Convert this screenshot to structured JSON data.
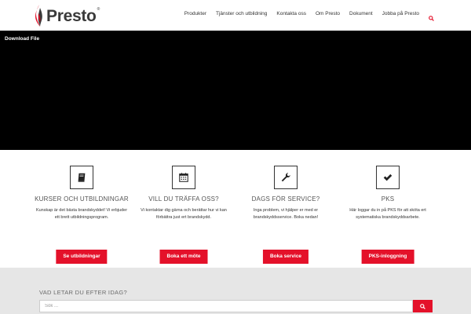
{
  "brand": {
    "name": "Presto",
    "registered": "®",
    "accent": "#e4112a"
  },
  "nav": {
    "items": [
      "Produkter",
      "Tjänster och utbildning",
      "Kontakta oss",
      "Om Presto",
      "Dokument",
      "Jobba på Presto"
    ]
  },
  "video": {
    "label": "Download File"
  },
  "features": [
    {
      "icon": "book-icon",
      "title": "KURSER OCH UTBILDNINGAR",
      "desc": "Kunskap är det bästa brandskyddet! Vi erbjuder ett brett utbildningsprogram.",
      "button": "Se utbildningar"
    },
    {
      "icon": "calendar-icon",
      "title": "VILL DU TRÄFFA OSS?",
      "desc": "Vi kontaktar dig gärna och berättar hur vi kan förbättra just ert brandskydd.",
      "button": "Boka ett möte"
    },
    {
      "icon": "wrench-icon",
      "title": "DAGS FÖR SERVICE?",
      "desc": "Inga problem, vi hjälper er med er brandskyddsservice. Boka nedan!",
      "button": "Boka service"
    },
    {
      "icon": "check-icon",
      "title": "PKS",
      "desc": "Här loggar du in på PKS för att sköta ert systematiska brandskyddsarbete.",
      "button": "PKS-inloggning"
    }
  ],
  "search": {
    "title": "VAD LETAR DU EFTER IDAG?",
    "placeholder": "Sök ..."
  }
}
